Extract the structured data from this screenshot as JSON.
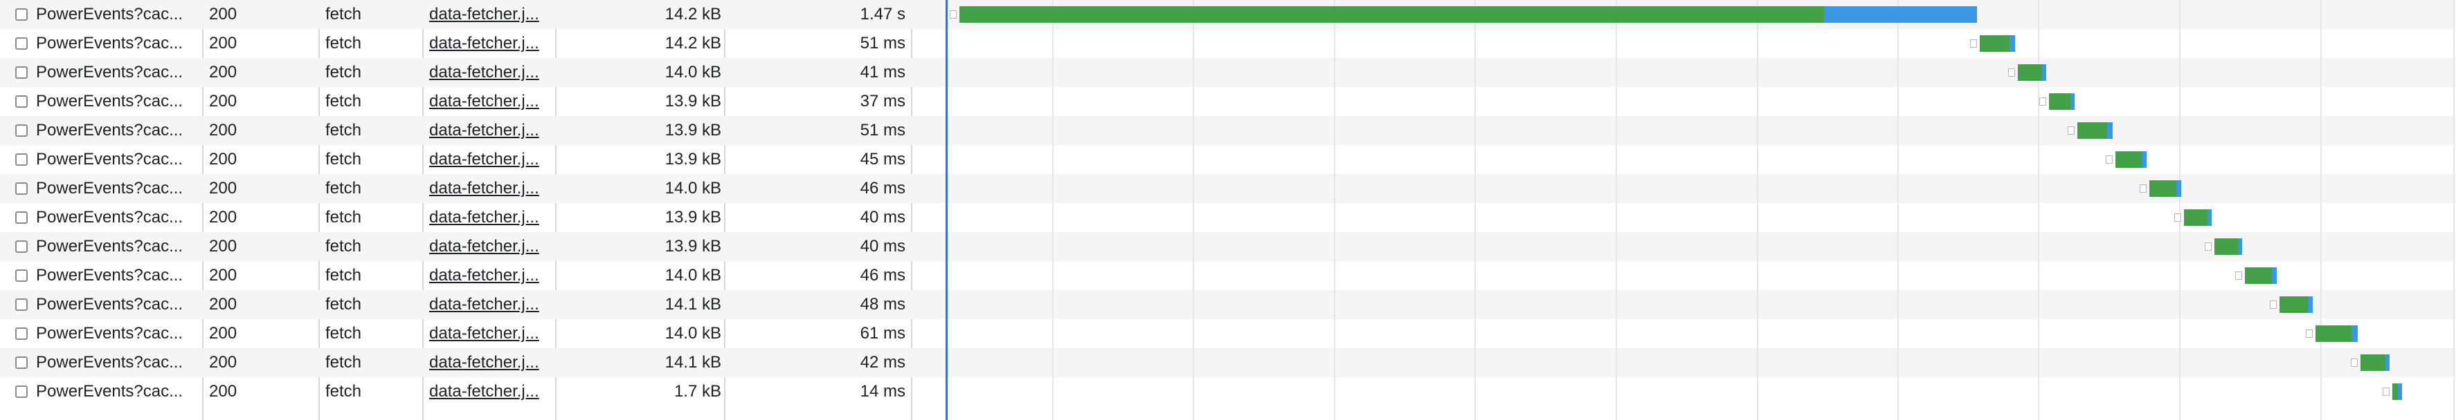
{
  "network": {
    "rows": [
      {
        "name": "PowerEvents?cac...",
        "status": "200",
        "type": "fetch",
        "initiator": "data-fetcher.j...",
        "size": "14.2 kB",
        "time": "1.47 s",
        "time_ms": 1470
      },
      {
        "name": "PowerEvents?cac...",
        "status": "200",
        "type": "fetch",
        "initiator": "data-fetcher.j...",
        "size": "14.2 kB",
        "time": "51 ms",
        "time_ms": 51
      },
      {
        "name": "PowerEvents?cac...",
        "status": "200",
        "type": "fetch",
        "initiator": "data-fetcher.j...",
        "size": "14.0 kB",
        "time": "41 ms",
        "time_ms": 41
      },
      {
        "name": "PowerEvents?cac...",
        "status": "200",
        "type": "fetch",
        "initiator": "data-fetcher.j...",
        "size": "13.9 kB",
        "time": "37 ms",
        "time_ms": 37
      },
      {
        "name": "PowerEvents?cac...",
        "status": "200",
        "type": "fetch",
        "initiator": "data-fetcher.j...",
        "size": "13.9 kB",
        "time": "51 ms",
        "time_ms": 51
      },
      {
        "name": "PowerEvents?cac...",
        "status": "200",
        "type": "fetch",
        "initiator": "data-fetcher.j...",
        "size": "13.9 kB",
        "time": "45 ms",
        "time_ms": 45
      },
      {
        "name": "PowerEvents?cac...",
        "status": "200",
        "type": "fetch",
        "initiator": "data-fetcher.j...",
        "size": "14.0 kB",
        "time": "46 ms",
        "time_ms": 46
      },
      {
        "name": "PowerEvents?cac...",
        "status": "200",
        "type": "fetch",
        "initiator": "data-fetcher.j...",
        "size": "13.9 kB",
        "time": "40 ms",
        "time_ms": 40
      },
      {
        "name": "PowerEvents?cac...",
        "status": "200",
        "type": "fetch",
        "initiator": "data-fetcher.j...",
        "size": "13.9 kB",
        "time": "40 ms",
        "time_ms": 40
      },
      {
        "name": "PowerEvents?cac...",
        "status": "200",
        "type": "fetch",
        "initiator": "data-fetcher.j...",
        "size": "14.0 kB",
        "time": "46 ms",
        "time_ms": 46
      },
      {
        "name": "PowerEvents?cac...",
        "status": "200",
        "type": "fetch",
        "initiator": "data-fetcher.j...",
        "size": "14.1 kB",
        "time": "48 ms",
        "time_ms": 48
      },
      {
        "name": "PowerEvents?cac...",
        "status": "200",
        "type": "fetch",
        "initiator": "data-fetcher.j...",
        "size": "14.0 kB",
        "time": "61 ms",
        "time_ms": 61
      },
      {
        "name": "PowerEvents?cac...",
        "status": "200",
        "type": "fetch",
        "initiator": "data-fetcher.j...",
        "size": "14.1 kB",
        "time": "42 ms",
        "time_ms": 42
      },
      {
        "name": "PowerEvents?cac...",
        "status": "200",
        "type": "fetch",
        "initiator": "data-fetcher.j...",
        "size": "1.7 kB",
        "time": "14 ms",
        "time_ms": 14
      }
    ]
  },
  "colors": {
    "download_bar": "#44a046",
    "receive_bar": "#3b97e3",
    "start_line": "#3b6fd6",
    "row_stripe": "#f5f5f5"
  },
  "icons": {
    "row_checkbox": "checkbox-icon"
  }
}
